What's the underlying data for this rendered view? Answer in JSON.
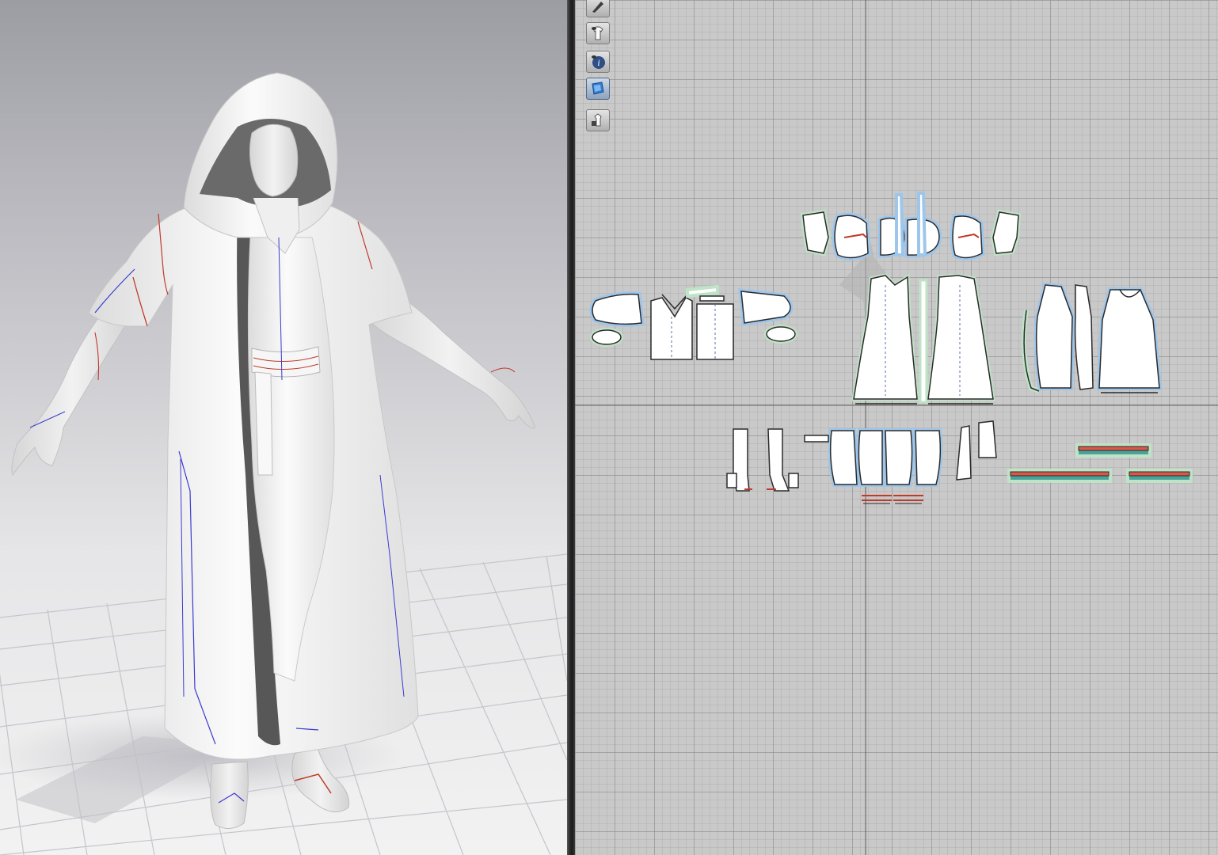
{
  "viewport_3d": {
    "floor": "floor-grid",
    "garment": "hooded-robe",
    "avatar": "male-avatar"
  },
  "window_2d": {
    "toolbar": [
      {
        "icon": "edit-pen-icon"
      },
      {
        "icon": "show-garment-icon"
      },
      {
        "icon": "info-icon"
      },
      {
        "icon": "texture-icon"
      },
      {
        "icon": "lock-garment-icon"
      }
    ],
    "pattern_groups": [
      "hood-pieces",
      "sleeve-pieces",
      "shirt-pieces",
      "robe-front-pieces",
      "robe-back-pieces",
      "sock-pieces",
      "pants-pieces",
      "small-pieces",
      "belt-strips"
    ]
  },
  "colors": {
    "background_3d": "#b5b5bb",
    "background_2d": "#c9c9c9",
    "pattern_fill": "#ffffff",
    "pattern_outline": "#2b2b2b",
    "pattern_highlight_blue": "#9ec6ea",
    "pattern_highlight_green": "#bfe3c6",
    "seam_red": "#c0392b",
    "seam_blue": "#3a3ad0",
    "belt_teal": "#4aa39a",
    "belt_red": "#d9574a"
  }
}
